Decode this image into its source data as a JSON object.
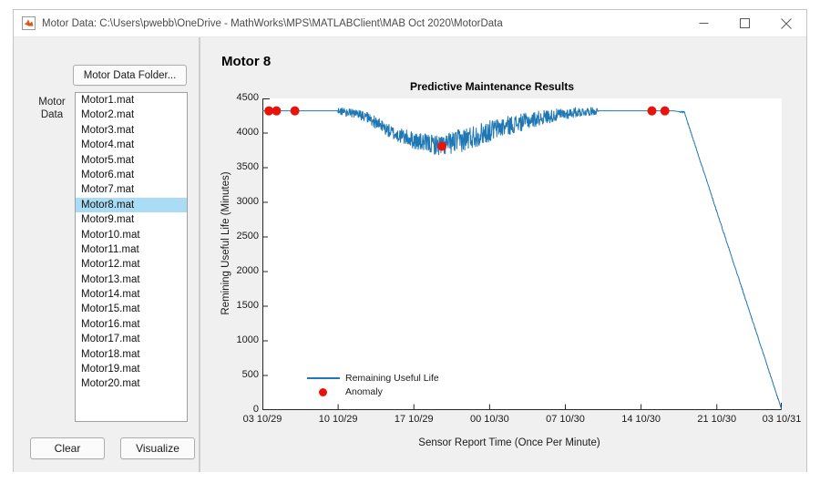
{
  "window": {
    "title": "Motor Data: C:\\Users\\pwebb\\OneDrive - MathWorks\\MPS\\MATLABClient\\MAB Oct 2020\\MotorData",
    "app_icon": "matlab-icon",
    "controls": {
      "minimize": "minimize-icon",
      "maximize": "maximize-icon",
      "close": "close-icon"
    }
  },
  "sidebar": {
    "folder_button_label": "Motor Data Folder...",
    "list_label": "Motor\nData",
    "list_label_line1": "Motor",
    "list_label_line2": "Data",
    "selected_index": 7,
    "items": [
      "Motor1.mat",
      "Motor2.mat",
      "Motor3.mat",
      "Motor4.mat",
      "Motor5.mat",
      "Motor6.mat",
      "Motor7.mat",
      "Motor8.mat",
      "Motor9.mat",
      "Motor10.mat",
      "Motor11.mat",
      "Motor12.mat",
      "Motor13.mat",
      "Motor14.mat",
      "Motor15.mat",
      "Motor16.mat",
      "Motor17.mat",
      "Motor18.mat",
      "Motor19.mat",
      "Motor20.mat"
    ],
    "clear_button_label": "Clear",
    "visualize_button_label": "Visualize"
  },
  "main": {
    "heading": "Motor 8"
  },
  "colors": {
    "line": "#1f77b4",
    "anomaly": "#e8140a",
    "selection": "#aadcf5",
    "panel": "#f0f0f0",
    "plot_bg": "#ffffff",
    "axis": "#262626"
  },
  "chart_data": {
    "type": "line",
    "title": "Predictive Maintenance Results",
    "xlabel": "Sensor Report Time (Once Per Minute)",
    "ylabel": "Remining Useful Life (Minutes)",
    "ylim": [
      0,
      4500
    ],
    "yticks": [
      0,
      500,
      1000,
      1500,
      2000,
      2500,
      3000,
      3500,
      4000,
      4500
    ],
    "ytick_labels": [
      "0",
      "500",
      "1000",
      "1500",
      "2000",
      "2500",
      "3000",
      "3500",
      "4000",
      "4500"
    ],
    "xticks": [
      0,
      7,
      14,
      21,
      28,
      35,
      42,
      48
    ],
    "xtick_labels": [
      "03 10/29",
      "10 10/29",
      "17 10/29",
      "00 10/30",
      "07 10/30",
      "14 10/30",
      "21 10/30",
      "03 10/31"
    ],
    "xlim_hours": [
      0,
      48
    ],
    "grid": false,
    "legend_position": "lower-left",
    "series": [
      {
        "name": "Remaining Useful Life",
        "color": "#1f77b4",
        "style": "line",
        "description": "Flat at ~4320 minutes until ~10 10/29, noisy dip down to ~3800 around 17 10/29, recovers to ~4320 by ~07 10/30, then declines linearly to 0 at 03 10/31",
        "key_points": [
          {
            "x_hours": 0,
            "y": 4320
          },
          {
            "x_hours": 7.0,
            "y": 4320
          },
          {
            "x_hours": 9.5,
            "y": 4250
          },
          {
            "x_hours": 12.0,
            "y": 4000
          },
          {
            "x_hours": 14.5,
            "y": 3870
          },
          {
            "x_hours": 16.5,
            "y": 3820
          },
          {
            "x_hours": 18.5,
            "y": 3900
          },
          {
            "x_hours": 22.0,
            "y": 4080
          },
          {
            "x_hours": 26.0,
            "y": 4230
          },
          {
            "x_hours": 29.0,
            "y": 4300
          },
          {
            "x_hours": 31.0,
            "y": 4320
          },
          {
            "x_hours": 38.0,
            "y": 4320
          },
          {
            "x_hours": 39.0,
            "y": 4300
          },
          {
            "x_hours": 48.0,
            "y": 0
          }
        ]
      },
      {
        "name": "Anomaly",
        "color": "#e8140a",
        "style": "scatter",
        "points": [
          {
            "x_hours": 0.6,
            "y": 4320
          },
          {
            "x_hours": 1.3,
            "y": 4320
          },
          {
            "x_hours": 3.0,
            "y": 4320
          },
          {
            "x_hours": 16.6,
            "y": 3810
          },
          {
            "x_hours": 36.0,
            "y": 4320
          },
          {
            "x_hours": 37.2,
            "y": 4320
          }
        ]
      }
    ],
    "legend": [
      "Remaining Useful Life",
      "Anomaly"
    ]
  }
}
